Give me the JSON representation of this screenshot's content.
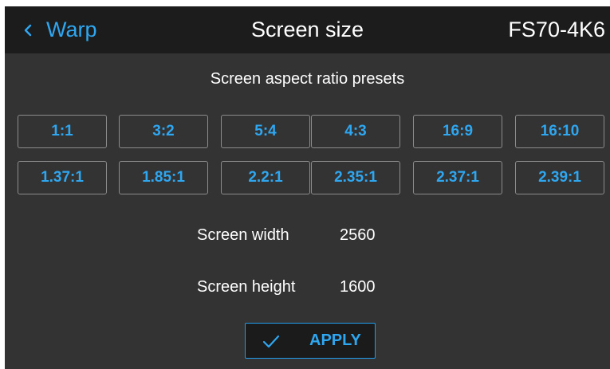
{
  "header": {
    "back_label": "Warp",
    "title": "Screen size",
    "device": "FS70-4K6"
  },
  "presets": {
    "title": "Screen aspect ratio presets",
    "row1": [
      "1:1",
      "3:2",
      "5:4",
      "4:3",
      "16:9",
      "16:10"
    ],
    "row2": [
      "1.37:1",
      "1.85:1",
      "2.2:1",
      "2.35:1",
      "2.37:1",
      "2.39:1"
    ]
  },
  "dimensions": {
    "width_label": "Screen width",
    "width_value": "2560",
    "height_label": "Screen height",
    "height_value": "1600"
  },
  "apply_label": "APPLY",
  "icons": {
    "back": "chevron-left-icon",
    "apply": "check-icon"
  },
  "colors": {
    "background": "#333333",
    "header": "#1c1c1c",
    "accent": "#2ea6f0",
    "button_border": "#8c8c8c"
  }
}
